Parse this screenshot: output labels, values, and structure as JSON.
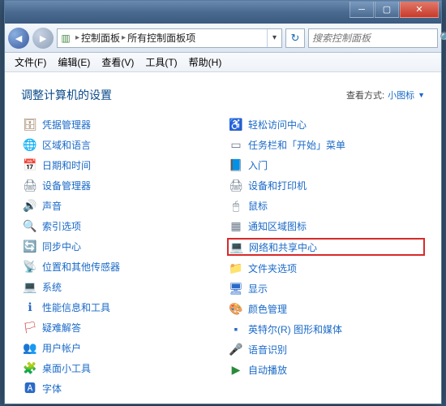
{
  "titlebar": {},
  "nav": {
    "breadcrumb": {
      "root": "控制面板",
      "current": "所有控制面板项"
    },
    "search_placeholder": "搜索控制面板"
  },
  "menus": {
    "file": "文件(F)",
    "edit": "编辑(E)",
    "view": "查看(V)",
    "tools": "工具(T)",
    "help": "帮助(H)"
  },
  "heading": "调整计算机的设置",
  "view_by": {
    "label": "查看方式:",
    "value": "小图标"
  },
  "left_items": [
    {
      "icon": "🗄",
      "cls": "c-brown",
      "label": "凭据管理器"
    },
    {
      "icon": "🌐",
      "cls": "c-blue",
      "label": "区域和语言"
    },
    {
      "icon": "📅",
      "cls": "c-teal",
      "label": "日期和时间"
    },
    {
      "icon": "🖨",
      "cls": "c-gray",
      "label": "设备管理器"
    },
    {
      "icon": "🔊",
      "cls": "c-gray",
      "label": "声音"
    },
    {
      "icon": "🔍",
      "cls": "c-orange",
      "label": "索引选项"
    },
    {
      "icon": "🔄",
      "cls": "c-green",
      "label": "同步中心"
    },
    {
      "icon": "📡",
      "cls": "c-green",
      "label": "位置和其他传感器"
    },
    {
      "icon": "💻",
      "cls": "c-blue",
      "label": "系统"
    },
    {
      "icon": "ℹ",
      "cls": "c-blue",
      "label": "性能信息和工具"
    },
    {
      "icon": "🏳",
      "cls": "c-red",
      "label": "疑难解答"
    },
    {
      "icon": "👥",
      "cls": "c-green",
      "label": "用户帐户"
    },
    {
      "icon": "🧩",
      "cls": "c-orange",
      "label": "桌面小工具"
    },
    {
      "icon": "🅰",
      "cls": "c-blue",
      "label": "字体"
    }
  ],
  "right_items": [
    {
      "icon": "♿",
      "cls": "c-blue",
      "label": "轻松访问中心"
    },
    {
      "icon": "▭",
      "cls": "c-gray",
      "label": "任务栏和「开始」菜单"
    },
    {
      "icon": "📘",
      "cls": "c-blue",
      "label": "入门"
    },
    {
      "icon": "🖨",
      "cls": "c-gray",
      "label": "设备和打印机"
    },
    {
      "icon": "🖱",
      "cls": "c-gray",
      "label": "鼠标"
    },
    {
      "icon": "▦",
      "cls": "c-gray",
      "label": "通知区域图标"
    },
    {
      "icon": "💻",
      "cls": "c-blue",
      "label": "网络和共享中心",
      "highlight": true
    },
    {
      "icon": "📁",
      "cls": "c-orange",
      "label": "文件夹选项"
    },
    {
      "icon": "🖥",
      "cls": "c-blue",
      "label": "显示"
    },
    {
      "icon": "🎨",
      "cls": "c-purple",
      "label": "颜色管理"
    },
    {
      "icon": "▪",
      "cls": "c-blue",
      "label": "英特尔(R) 图形和媒体"
    },
    {
      "icon": "🎤",
      "cls": "c-gray",
      "label": "语音识别"
    },
    {
      "icon": "▶",
      "cls": "c-green",
      "label": "自动播放"
    }
  ]
}
